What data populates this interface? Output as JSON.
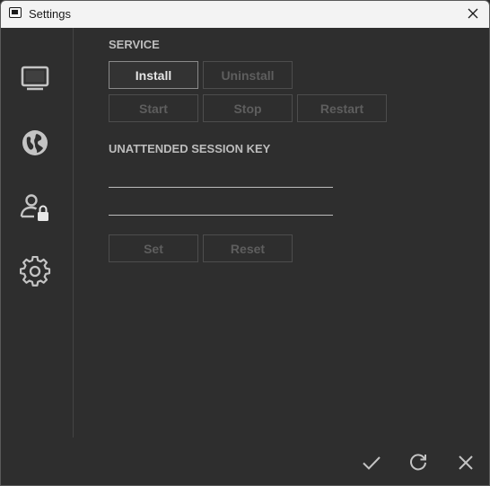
{
  "window": {
    "title": "Settings"
  },
  "sidebar": {
    "items": [
      {
        "name": "display",
        "icon": "monitor-icon"
      },
      {
        "name": "network",
        "icon": "globe-icon"
      },
      {
        "name": "security",
        "icon": "user-lock-icon"
      },
      {
        "name": "general",
        "icon": "gear-icon"
      }
    ]
  },
  "service": {
    "title": "SERVICE",
    "install_label": "Install",
    "uninstall_label": "Uninstall",
    "start_label": "Start",
    "stop_label": "Stop",
    "restart_label": "Restart"
  },
  "session_key": {
    "title": "UNATTENDED SESSION KEY",
    "key_value": "",
    "confirm_value": "",
    "set_label": "Set",
    "reset_label": "Reset"
  },
  "footer": {
    "icons": [
      "checkmark-icon",
      "refresh-icon",
      "close-icon"
    ]
  },
  "colors": {
    "background": "#2e2e2e",
    "titlebar": "#f3f3f3",
    "icon": "#c4c4c4",
    "disabled_text": "#5e5e5e",
    "enabled_text": "#e6e6e6"
  }
}
